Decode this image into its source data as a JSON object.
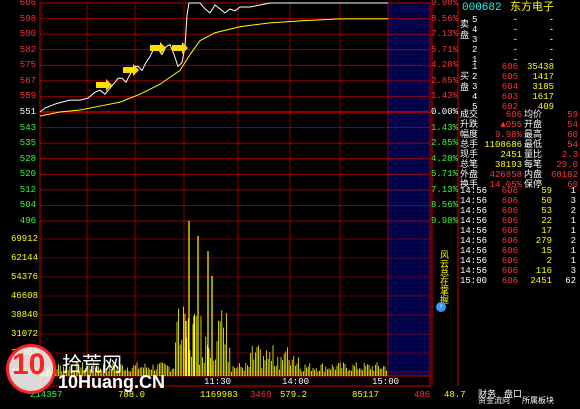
{
  "stock": {
    "code": "000682",
    "name": "东方电子"
  },
  "price_axis": {
    "labels": [
      "606",
      "598",
      "590",
      "582",
      "575",
      "567",
      "559",
      "551",
      "543",
      "535",
      "528",
      "520",
      "512",
      "504",
      "496"
    ],
    "pct_labels": [
      "9.98%",
      "8.56%",
      "7.13%",
      "5.71%",
      "4.28%",
      "2.85%",
      "1.43%",
      "0.00%",
      "1.43%",
      "2.85%",
      "4.28%",
      "5.71%",
      "7.13%",
      "8.56%",
      "9.98%"
    ]
  },
  "volume_axis": {
    "labels": [
      "69912",
      "62144",
      "54376",
      "46608",
      "38840",
      "31072",
      "23304",
      "15536"
    ]
  },
  "time_axis": {
    "labels": [
      "11:30",
      "14:00",
      "15:00"
    ]
  },
  "side_tab": {
    "label": "风云总在掌握",
    "icon": "circle-arrow-icon"
  },
  "order_book": {
    "sell_label": "卖盘",
    "buy_label": "买盘",
    "sell": [
      {
        "level": "5",
        "price": "-",
        "qty": "-"
      },
      {
        "level": "4",
        "price": "-",
        "qty": "-"
      },
      {
        "level": "3",
        "price": "-",
        "qty": "-"
      },
      {
        "level": "2",
        "price": "-",
        "qty": "-"
      },
      {
        "level": "1",
        "price": "-",
        "qty": "-"
      }
    ],
    "buy": [
      {
        "level": "1",
        "price": "606",
        "qty": "35438"
      },
      {
        "level": "2",
        "price": "605",
        "qty": "1417"
      },
      {
        "level": "3",
        "price": "604",
        "qty": "3185"
      },
      {
        "level": "4",
        "price": "603",
        "qty": "1617"
      },
      {
        "level": "5",
        "price": "602",
        "qty": "409"
      }
    ]
  },
  "stats": [
    {
      "l1": "成交",
      "v1": "606",
      "l2": "均价",
      "v2": "59"
    },
    {
      "l1": "升跌",
      "v1": "▲055",
      "l2": "开盘",
      "v2": "54"
    },
    {
      "l1": "幅度",
      "v1": "9.98%",
      "l2": "最高",
      "v2": "60"
    },
    {
      "l1": "总手",
      "v1": "1108686",
      "l2": "最低",
      "v2": "54"
    },
    {
      "l1": "现手",
      "v1": "2451",
      "l2": "量比",
      "v2": "2.3"
    },
    {
      "l1": "总笔",
      "v1": "38193",
      "l2": "每笔",
      "v2": "29.0"
    },
    {
      "l1": "外盘",
      "v1": "426858",
      "l2": "内盘",
      "v2": "68182"
    },
    {
      "l1": "换手",
      "v1": "14.05%",
      "l2": "保停",
      "v2": "60"
    }
  ],
  "ticks": [
    {
      "time": "14:56",
      "price": "606",
      "vol": "59",
      "n": "1"
    },
    {
      "time": "14:56",
      "price": "606",
      "vol": "50",
      "n": "3"
    },
    {
      "time": "14:56",
      "price": "606",
      "vol": "53",
      "n": "2"
    },
    {
      "time": "14:56",
      "price": "606",
      "vol": "22",
      "n": "1"
    },
    {
      "time": "14:56",
      "price": "606",
      "vol": "17",
      "n": "1"
    },
    {
      "time": "14:56",
      "price": "606",
      "vol": "279",
      "n": "2"
    },
    {
      "time": "14:56",
      "price": "606",
      "vol": "15",
      "n": "1"
    },
    {
      "time": "14:56",
      "price": "606",
      "vol": "2",
      "n": "1"
    },
    {
      "time": "14:56",
      "price": "606",
      "vol": "116",
      "n": "3"
    },
    {
      "time": "15:00",
      "price": "606",
      "vol": "2451",
      "n": "62"
    }
  ],
  "bottom": {
    "b1": "214357",
    "b2": "788.0",
    "b3": "1169983",
    "b4": "3469",
    "b5": "579.2",
    "b6": "85117",
    "b7": "486",
    "b8": "48.7",
    "tab1": "财务",
    "tab2": "盘口",
    "tab3": "资金流向",
    "tab4": "所属板块"
  },
  "watermark": {
    "number": "10",
    "cn": "拾荒网",
    "url": "10Huang.CN"
  },
  "colors": {
    "up": "#ff3333",
    "down": "#33ff33",
    "grid": "#cc0000",
    "price_line": "#ffffff",
    "avg_line": "#ffff00",
    "volume": "#ffff00",
    "after_hours": "#000080"
  }
}
